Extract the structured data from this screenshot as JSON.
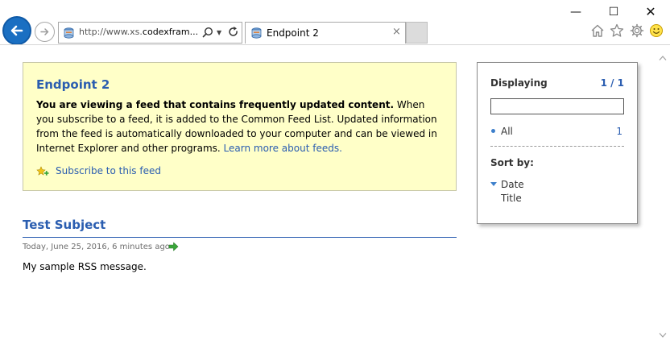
{
  "window": {
    "minimize_label": "—",
    "maximize_label": "☐",
    "close_label": "✕"
  },
  "navigation": {
    "back_icon": "back-arrow-icon",
    "forward_icon": "forward-arrow-icon"
  },
  "address_bar": {
    "url_prefix": "http://www.xs.",
    "url_host": "codexfram...",
    "search_icon": "search-icon",
    "dropdown_icon": "chevron-down-icon",
    "refresh_icon": "refresh-icon"
  },
  "tab": {
    "title": "Endpoint 2",
    "close_label": "×"
  },
  "toolbar": {
    "icons": [
      "home-icon",
      "star-icon",
      "gear-icon",
      "smiley-icon"
    ]
  },
  "feed_info": {
    "title": "Endpoint 2",
    "bold_text": "You are viewing a feed that contains frequently updated content.",
    "body_text": " When you subscribe to a feed, it is added to the Common Feed List. Updated information from the feed is automatically downloaded to your computer and can be viewed in Internet Explorer and other programs. ",
    "learn_more_link": "Learn more about feeds.",
    "subscribe_link": "Subscribe to this feed"
  },
  "feed_item": {
    "title": "Test Subject",
    "date": "Today, June 25, 2016, 6 minutes ago",
    "body": "My sample RSS message."
  },
  "side_panel": {
    "displaying_label": "Displaying",
    "displaying_count": "1 / 1",
    "filter_value": "",
    "all_label": "All",
    "all_count": "1",
    "sort_heading": "Sort by:",
    "sort_options": [
      "Date",
      "Title"
    ]
  },
  "colors": {
    "link_blue": "#2a5db0",
    "info_background": "#ffffc8",
    "back_button_blue": "#1a6fc2"
  }
}
